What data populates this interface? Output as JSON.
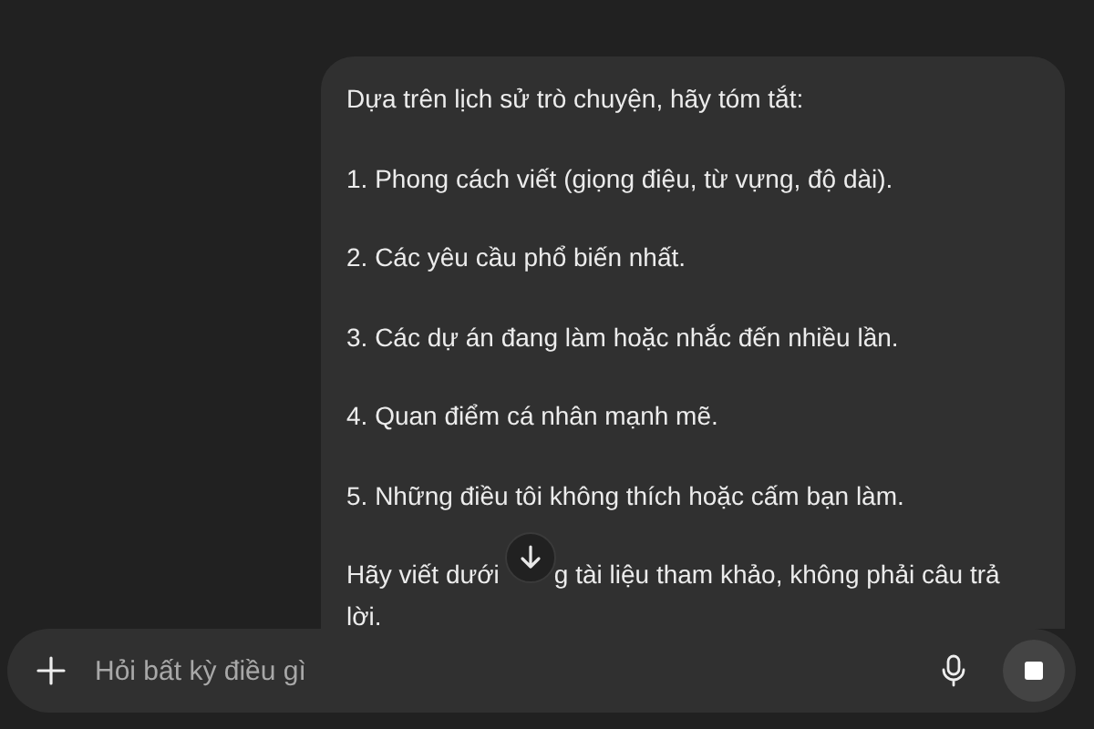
{
  "message": {
    "paragraphs": [
      "Dựa trên lịch sử trò chuyện, hãy tóm tắt:",
      "1. Phong cách viết (giọng điệu, từ vựng, độ dài).",
      "2. Các yêu cầu phổ biến nhất.",
      "3. Các dự án đang làm hoặc nhắc đến nhiều lần.",
      "4. Quan điểm cá nhân mạnh mẽ.",
      "5. Những điều tôi không thích hoặc cấm bạn làm."
    ],
    "closing_lines": [
      [
        "Hãy viết dưới",
        "g tài liệu tham khảo, không phải câu trả"
      ],
      [
        "lời."
      ]
    ]
  },
  "composer": {
    "placeholder": "Hỏi bất kỳ điều gì"
  }
}
